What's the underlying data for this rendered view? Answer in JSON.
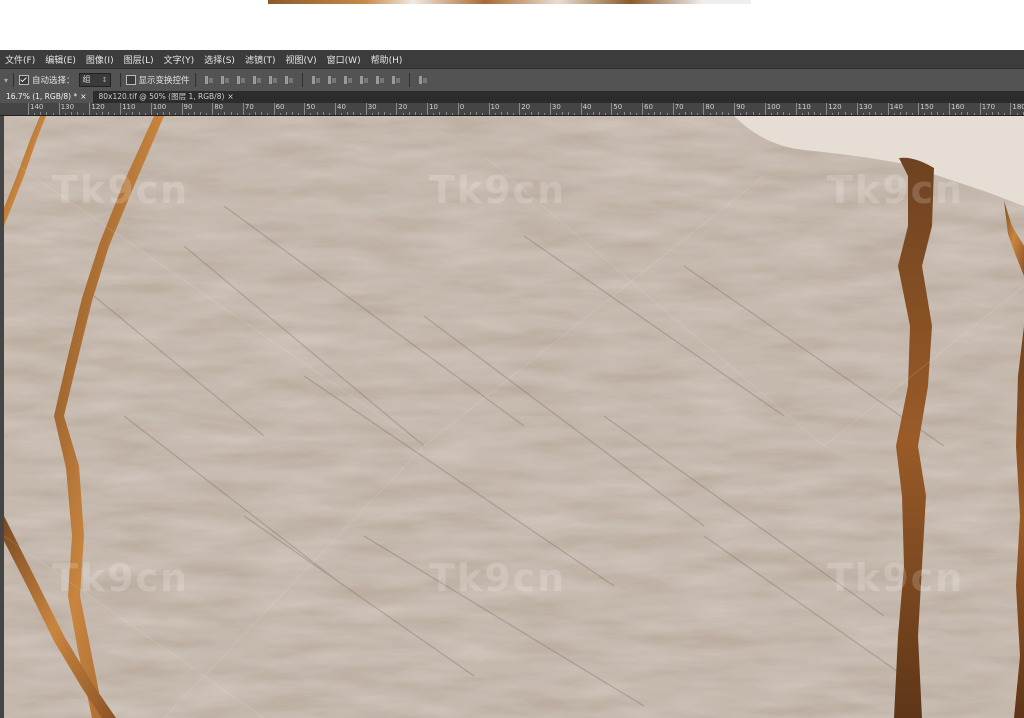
{
  "menu": [
    "文件(F)",
    "编辑(E)",
    "图像(I)",
    "图层(L)",
    "文字(Y)",
    "选择(S)",
    "滤镜(T)",
    "视图(V)",
    "窗口(W)",
    "帮助(H)"
  ],
  "options": {
    "auto_select_label": "自动选择：",
    "auto_select_value": "组",
    "show_transform_label": "显示变换控件"
  },
  "tabs": [
    {
      "label": "16.7% (1, RGB/8) *"
    },
    {
      "label": "80x120.tif @ 50% (图层 1, RGB/8)"
    }
  ],
  "ruler_labels": [
    "140",
    "130",
    "120",
    "110",
    "100",
    "90",
    "80",
    "70",
    "60",
    "50",
    "40",
    "30",
    "20",
    "10",
    "0",
    "10",
    "20",
    "30",
    "40",
    "50",
    "60",
    "70",
    "80",
    "90",
    "100",
    "110",
    "120",
    "130",
    "140",
    "150",
    "160",
    "170",
    "180"
  ],
  "watermark_text": "Tk9cn",
  "colors": {
    "canvas_bg": "#bcada0",
    "crack": "#b0723a",
    "crack_dark": "#6e4220",
    "wall_light": "#e6ddd5"
  }
}
